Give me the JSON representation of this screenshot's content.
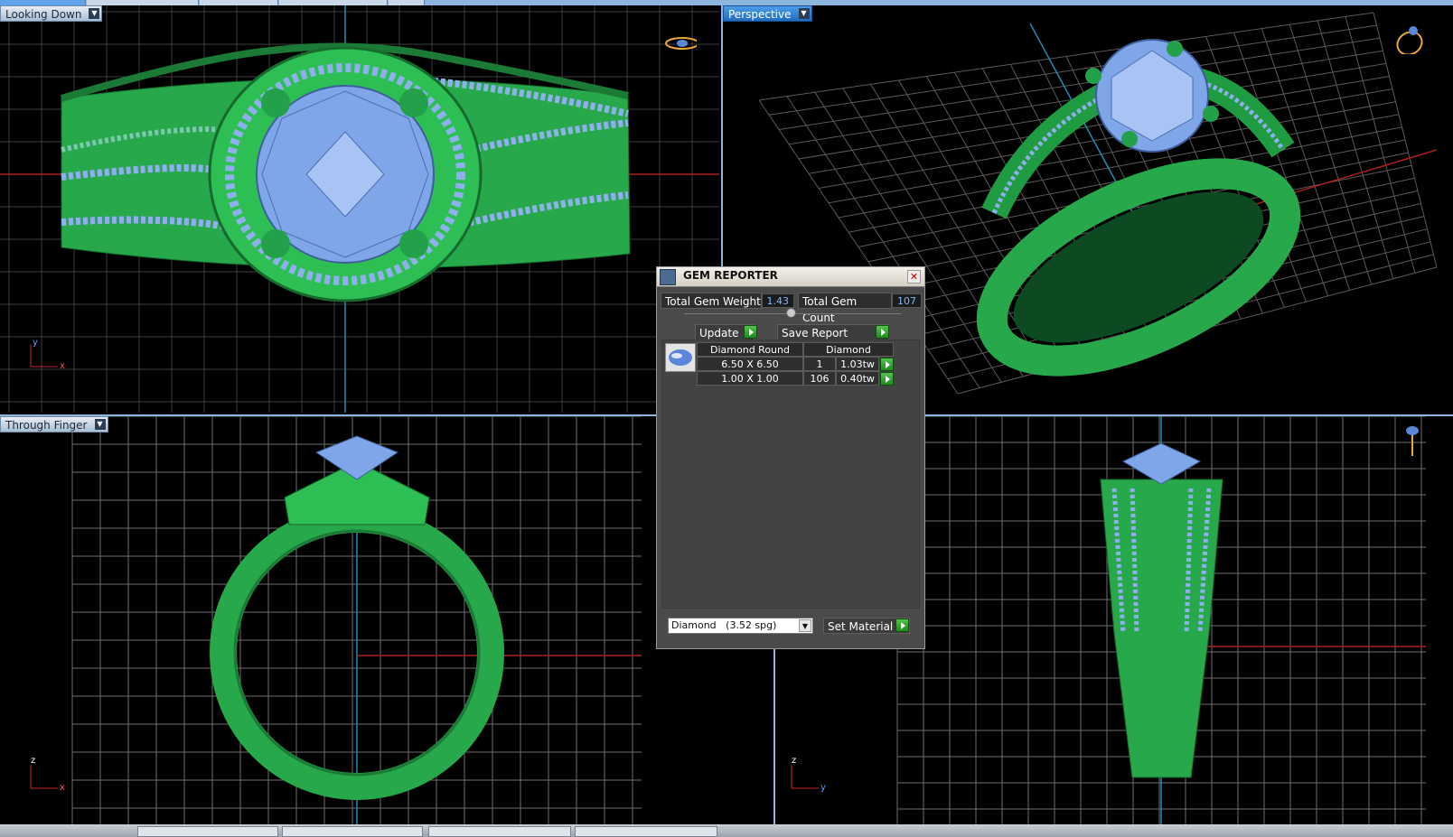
{
  "viewports": {
    "top_left": {
      "label": "Looking Down",
      "axis_x": "x",
      "axis_y": "y"
    },
    "top_right": {
      "label": "Perspective"
    },
    "bottom_left": {
      "label": "Through Finger",
      "axis_x": "x",
      "axis_y": "z"
    },
    "bottom_right": {
      "axis_x": "y",
      "axis_y": "z"
    }
  },
  "gem_reporter": {
    "title": "GEM REPORTER",
    "total_weight_label": "Total Gem Weight",
    "total_weight_value": "1.43",
    "total_count_label": "Total Gem Count",
    "total_count_value": "107",
    "update_label": "Update",
    "save_report_label": "Save Report",
    "table": {
      "header_shape": "Diamond Round",
      "header_material": "Diamond",
      "rows": [
        {
          "size": "6.50 X 6.50",
          "count": "1",
          "weight": "1.03tw"
        },
        {
          "size": "1.00 X 1.00",
          "count": "106",
          "weight": "0.40tw"
        }
      ]
    },
    "material_select": "Diamond   (3.52 spg)",
    "set_material_label": "Set Material"
  },
  "colors": {
    "metal": "#2fc95a",
    "gem": "#8fb0ef",
    "grid": "#6e6e6e",
    "accent": "#1f6cc0"
  }
}
